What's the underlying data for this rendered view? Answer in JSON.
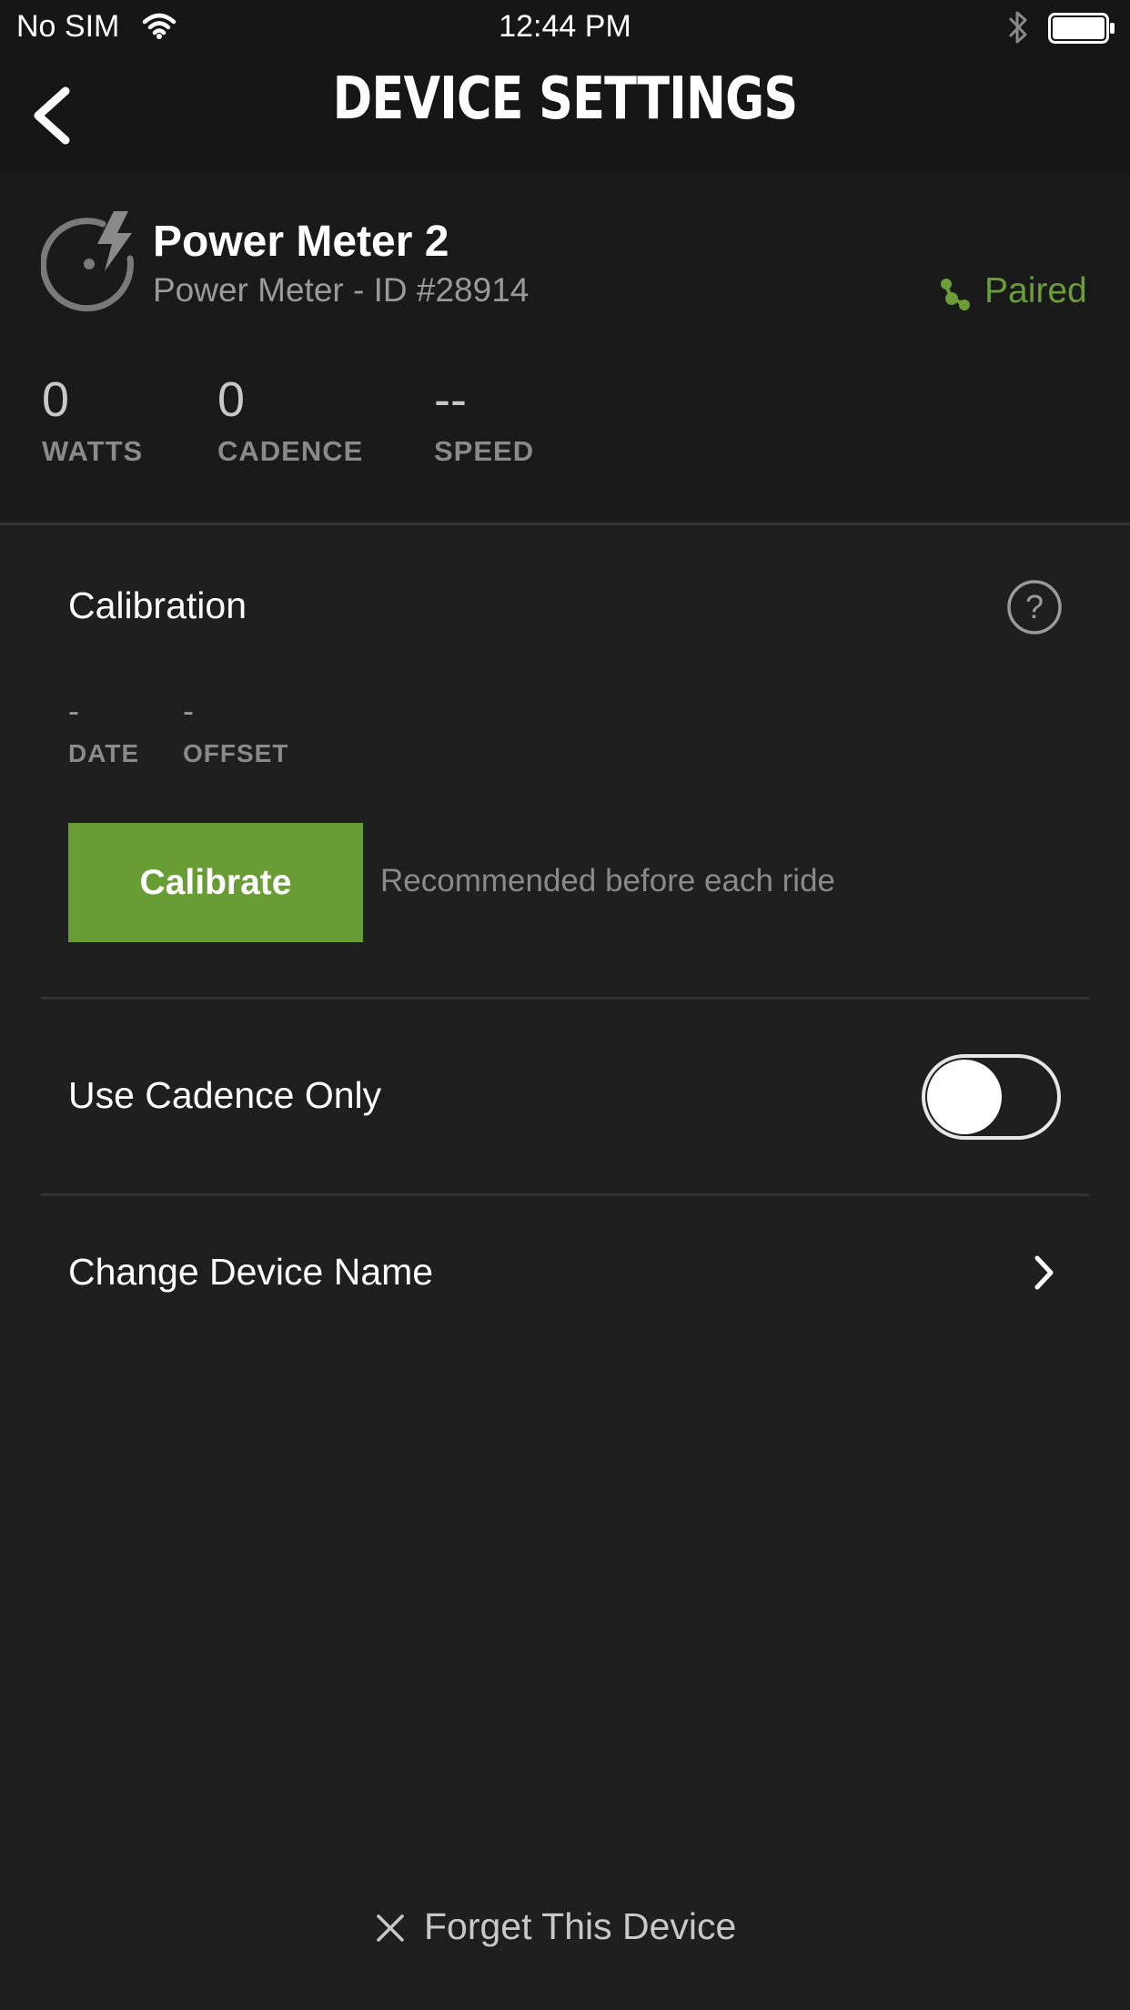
{
  "status_bar": {
    "carrier": "No SIM",
    "time": "12:44 PM"
  },
  "header": {
    "title": "DEVICE SETTINGS"
  },
  "device": {
    "name": "Power Meter 2",
    "subtitle": "Power Meter - ID #28914",
    "status": "Paired",
    "status_color": "#6a9e36",
    "stats": [
      {
        "value": "0",
        "label": "WATTS"
      },
      {
        "value": "0",
        "label": "CADENCE"
      },
      {
        "value": "--",
        "label": "SPEED"
      }
    ]
  },
  "calibration": {
    "title": "Calibration",
    "date_value": "-",
    "date_label": "DATE",
    "offset_value": "-",
    "offset_label": "OFFSET",
    "button_label": "Calibrate",
    "button_color": "#689c35",
    "hint": "Recommended before each ride"
  },
  "cadence_only": {
    "label": "Use Cadence Only",
    "enabled": false
  },
  "change_name": {
    "label": "Change Device Name"
  },
  "forget": {
    "label": "Forget This Device"
  }
}
